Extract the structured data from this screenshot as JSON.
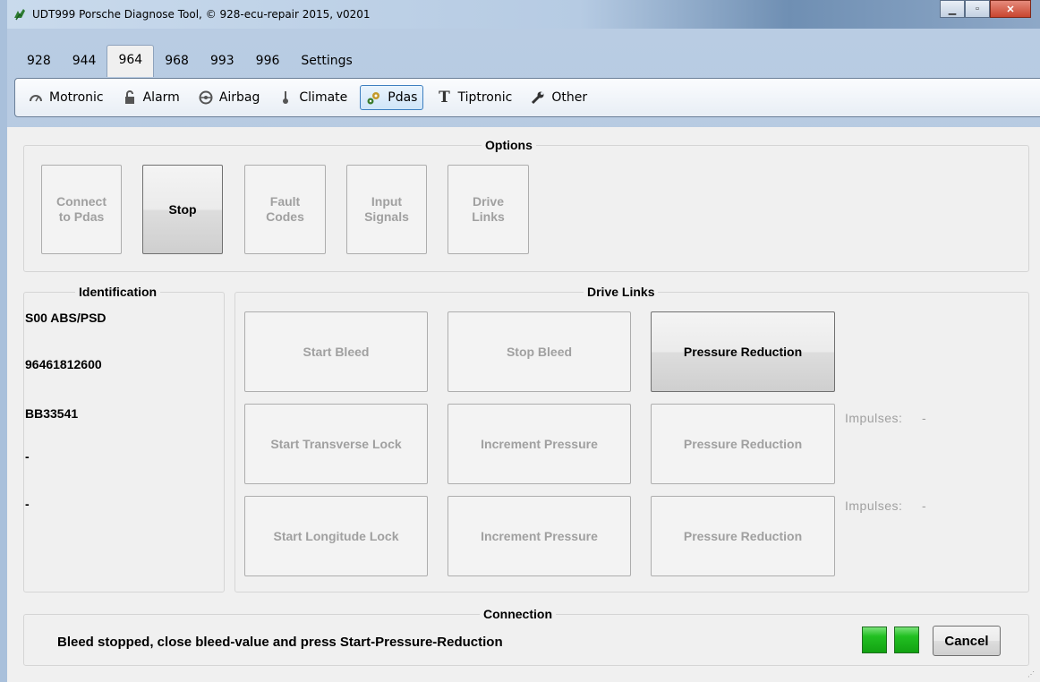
{
  "window": {
    "title": "UDT999 Porsche Diagnose Tool, © 928-ecu-repair 2015, v0201"
  },
  "tabs": [
    {
      "label": "928"
    },
    {
      "label": "944"
    },
    {
      "label": "964"
    },
    {
      "label": "968"
    },
    {
      "label": "993"
    },
    {
      "label": "996"
    },
    {
      "label": "Settings"
    }
  ],
  "active_tab": "964",
  "subtabs": [
    {
      "label": "Motronic",
      "icon": "gauge-icon"
    },
    {
      "label": "Alarm",
      "icon": "lock-icon"
    },
    {
      "label": "Airbag",
      "icon": "steering-wheel-icon"
    },
    {
      "label": "Climate",
      "icon": "thermometer-icon"
    },
    {
      "label": "Pdas",
      "icon": "gears-icon"
    },
    {
      "label": "Tiptronic",
      "icon": "t-icon"
    },
    {
      "label": "Other",
      "icon": "wrench-icon"
    }
  ],
  "active_subtab": "Pdas",
  "options": {
    "title": "Options",
    "buttons": [
      {
        "label": "Connect\nto Pdas"
      },
      {
        "label": "Stop"
      },
      {
        "label": "Fault\nCodes"
      },
      {
        "label": "Input\nSignals"
      },
      {
        "label": "Drive\nLinks"
      }
    ]
  },
  "identification": {
    "title": "Identification",
    "lines": [
      "S00 ABS/PSD",
      "96461812600",
      "BB33541",
      "-",
      "-"
    ]
  },
  "drive_links": {
    "title": "Drive Links",
    "row1": [
      "Start Bleed",
      "Stop Bleed",
      "Pressure Reduction"
    ],
    "row2": [
      "Start Transverse Lock",
      "Increment Pressure",
      "Pressure Reduction"
    ],
    "row3": [
      "Start Longitude Lock",
      "Increment Pressure",
      "Pressure Reduction"
    ],
    "impulses_label": "Impulses:",
    "impulses_row2": "-",
    "impulses_row3": "-"
  },
  "connection": {
    "title": "Connection",
    "status": "Bleed stopped, close bleed-value and press Start-Pressure-Reduction",
    "cancel_label": "Cancel",
    "led_color": "#22c022"
  }
}
